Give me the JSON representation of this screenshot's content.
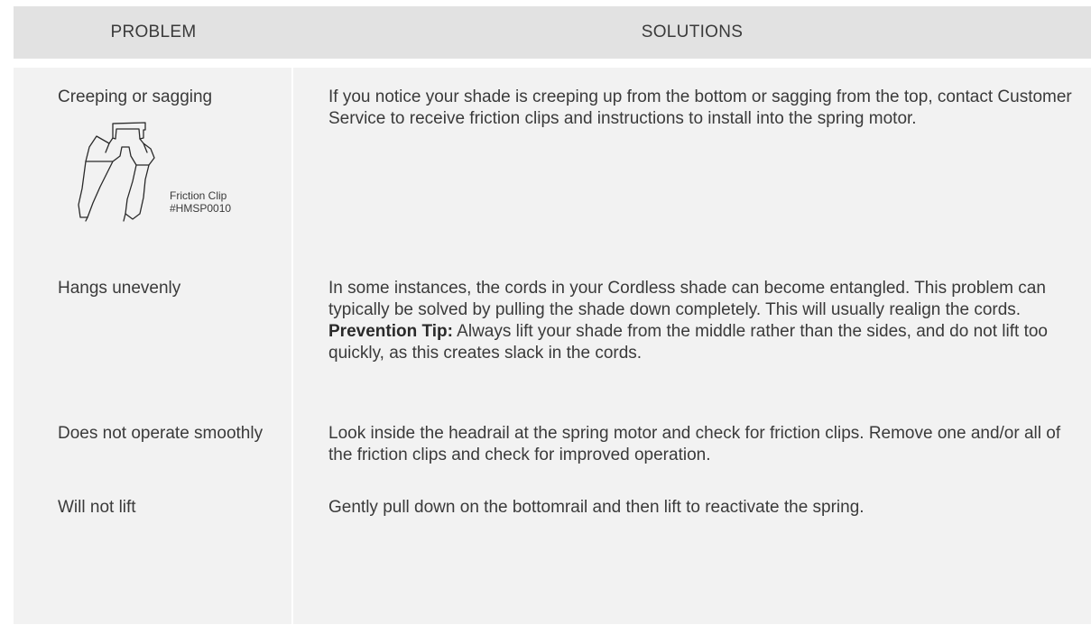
{
  "header": {
    "problem": "PROBLEM",
    "solutions": "SOLUTIONS"
  },
  "rows": [
    {
      "problem": "Creeping or sagging",
      "solution": "If you notice your shade is creeping up from the bottom or sagging from the top, contact Customer Service to receive friction clips and instructions to install into the spring motor."
    },
    {
      "problem": "Hangs unevenly",
      "solution": "In some instances, the cords in your Cordless shade can become entangled. This problem can typically be solved by pulling the shade down completely. This will usually realign the cords.",
      "tip_label": "Prevention Tip:",
      "tip_text": " Always lift your shade from the middle rather than the sides, and do not lift too quickly, as this creates slack in the cords."
    },
    {
      "problem": "Does not operate smoothly",
      "solution": "Look inside the headrail at the spring motor and check for friction clips. Remove one and/or all of the friction clips and check for improved operation."
    },
    {
      "problem": "Will not lift",
      "solution": "Gently pull down on the bottomrail and then lift to reactivate the spring."
    }
  ],
  "figure": {
    "caption_line1": "Friction Clip",
    "caption_line2": "#HMSP0010",
    "icon": "friction-clip-drawing"
  }
}
